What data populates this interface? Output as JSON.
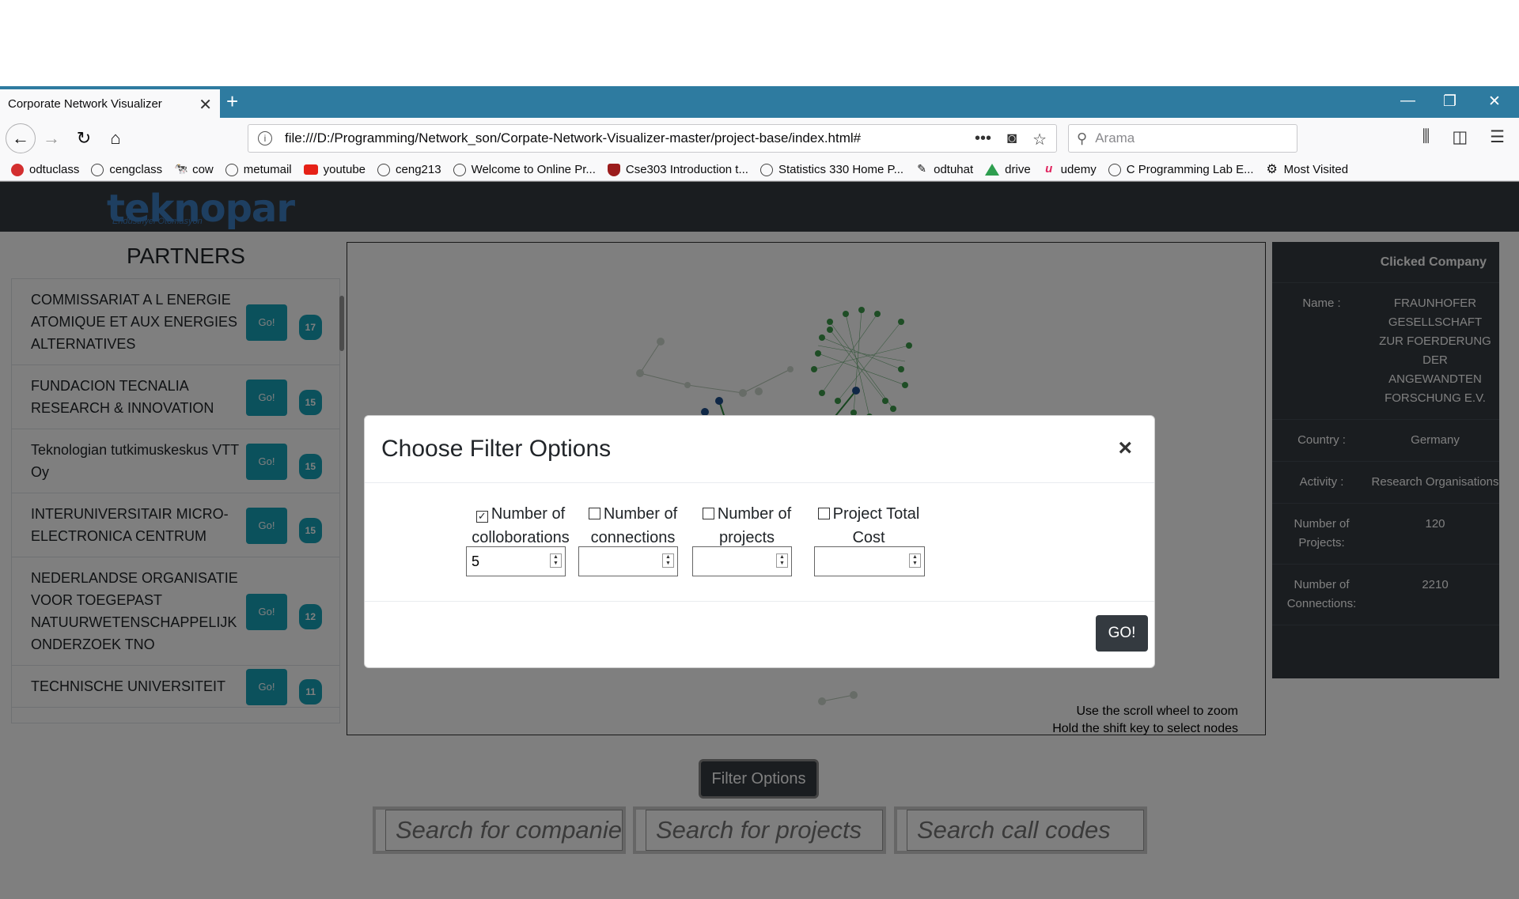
{
  "browser": {
    "tab_title": "Corporate Network Visualizer",
    "url": "file:///D:/Programming/Network_son/Corpate-Network-Visualizer-master/project-base/index.html#",
    "search_placeholder": "Arama",
    "bookmarks": [
      {
        "label": "odtuclass",
        "icon": "opera-icon"
      },
      {
        "label": "cengclass",
        "icon": "globe-icon"
      },
      {
        "label": "cow",
        "icon": "cow-icon"
      },
      {
        "label": "metumail",
        "icon": "globe-icon"
      },
      {
        "label": "youtube",
        "icon": "youtube-icon"
      },
      {
        "label": "ceng213",
        "icon": "globe-icon"
      },
      {
        "label": "Welcome to Online Pr...",
        "icon": "globe-icon"
      },
      {
        "label": "Cse303 Introduction t...",
        "icon": "shield-icon"
      },
      {
        "label": "Statistics 330 Home P...",
        "icon": "globe-icon"
      },
      {
        "label": "odtuhat",
        "icon": "odtuhat-icon"
      },
      {
        "label": "drive",
        "icon": "drive-icon"
      },
      {
        "label": "udemy",
        "icon": "udemy-icon"
      },
      {
        "label": "C Programming Lab E...",
        "icon": "globe-icon"
      },
      {
        "label": "Most Visited",
        "icon": "gear-icon"
      }
    ]
  },
  "header": {
    "logo": "teknopar",
    "logo_sub": "Endüstriyel Otomasyon"
  },
  "partners": {
    "title": "PARTNERS",
    "go_label": "Go!",
    "items": [
      {
        "name": "COMMISSARIAT A L ENERGIE ATOMIQUE ET AUX ENERGIES ALTERNATIVES",
        "count": "17"
      },
      {
        "name": "FUNDACION TECNALIA RESEARCH & INNOVATION",
        "count": "15"
      },
      {
        "name": "Teknologian tutkimuskeskus VTT Oy",
        "count": "15"
      },
      {
        "name": "INTERUNIVERSITAIR MICRO-ELECTRONICA CENTRUM",
        "count": "15"
      },
      {
        "name": "NEDERLANDSE ORGANISATIE VOOR TOEGEPAST NATUURWETENSCHAPPELIJK ONDERZOEK TNO",
        "count": "12"
      },
      {
        "name": "TECHNISCHE UNIVERSITEIT",
        "count": "11"
      }
    ]
  },
  "graph": {
    "hint1": "Use the scroll wheel to zoom",
    "hint2": "Hold the shift key to select nodes"
  },
  "clicked": {
    "title": "Clicked Company",
    "rows": [
      {
        "key": "Name :",
        "value": "FRAUNHOFER GESELLSCHAFT ZUR FOERDERUNG DER ANGEWANDTEN FORSCHUNG E.V."
      },
      {
        "key": "Country :",
        "value": "Germany"
      },
      {
        "key": "Activity :",
        "value": "Research Organisations"
      },
      {
        "key": "Number of Projects:",
        "value": "120"
      },
      {
        "key": "Number of Connections:",
        "value": "2210"
      }
    ]
  },
  "controls": {
    "filter_label": "Filter Options",
    "search_companies": "Search for companies",
    "search_projects": "Search for projects",
    "search_codes": "Search call codes"
  },
  "modal": {
    "title": "Choose Filter Options",
    "close": "×",
    "options": [
      {
        "label": "Number of colloborations",
        "checked": true,
        "value": "5"
      },
      {
        "label": "Number of connections",
        "checked": false,
        "value": ""
      },
      {
        "label": "Number of projects",
        "checked": false,
        "value": ""
      },
      {
        "label": "Project Total Cost",
        "checked": false,
        "value": ""
      }
    ],
    "go_label": "GO!"
  },
  "colors": {
    "accent": "#17a2b8",
    "dark": "#343a40",
    "tabbar": "#2e7ba0",
    "logo": "#3d7ec2"
  }
}
